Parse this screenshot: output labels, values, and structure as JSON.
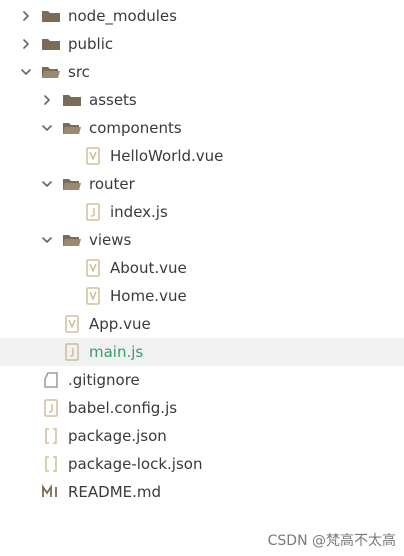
{
  "tree": [
    {
      "name": "node_modules",
      "type": "folder",
      "depth": 0,
      "expanded": false
    },
    {
      "name": "public",
      "type": "folder",
      "depth": 0,
      "expanded": false
    },
    {
      "name": "src",
      "type": "folder",
      "depth": 0,
      "expanded": true
    },
    {
      "name": "assets",
      "type": "folder",
      "depth": 1,
      "expanded": false
    },
    {
      "name": "components",
      "type": "folder",
      "depth": 1,
      "expanded": true
    },
    {
      "name": "HelloWorld.vue",
      "type": "vue",
      "depth": 2
    },
    {
      "name": "router",
      "type": "folder",
      "depth": 1,
      "expanded": true
    },
    {
      "name": "index.js",
      "type": "js",
      "depth": 2
    },
    {
      "name": "views",
      "type": "folder",
      "depth": 1,
      "expanded": true
    },
    {
      "name": "About.vue",
      "type": "vue",
      "depth": 2
    },
    {
      "name": "Home.vue",
      "type": "vue",
      "depth": 2
    },
    {
      "name": "App.vue",
      "type": "vue",
      "depth": 1
    },
    {
      "name": "main.js",
      "type": "js",
      "depth": 1,
      "selected": true
    },
    {
      "name": ".gitignore",
      "type": "git",
      "depth": 0
    },
    {
      "name": "babel.config.js",
      "type": "js",
      "depth": 0
    },
    {
      "name": "package.json",
      "type": "json",
      "depth": 0
    },
    {
      "name": "package-lock.json",
      "type": "json",
      "depth": 0
    },
    {
      "name": "README.md",
      "type": "md",
      "depth": 0
    }
  ],
  "watermark": "CSDN @梵高不太高",
  "colors": {
    "folder": "#7a6b57",
    "icon": "#c9b48a",
    "selected_text": "#3c9a6a",
    "selected_bg": "#f1f1f1"
  }
}
